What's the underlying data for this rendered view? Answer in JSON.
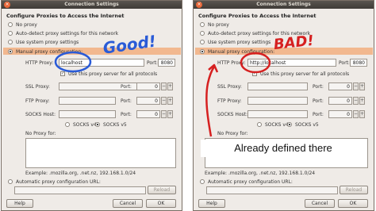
{
  "title": "Connection Settings",
  "heading": "Configure Proxies to Access the Internet",
  "options": {
    "no_proxy": "No proxy",
    "auto_detect": "Auto-detect proxy settings for this network",
    "system": "Use system proxy settings",
    "manual": "Manual proxy configuration:"
  },
  "labels": {
    "http_proxy": "HTTP Proxy:",
    "port": "Port:",
    "use_all": "Use this proxy server for all protocols",
    "ssl": "SSL Proxy:",
    "ftp": "FTP Proxy:",
    "socks": "SOCKS Host:",
    "socks_v4": "SOCKS v4",
    "socks_v5": "SOCKS v5",
    "no_proxy_for": "No Proxy for:",
    "example": "Example: .mozilla.org, .net.nz, 192.168.1.0/24",
    "auto_url": "Automatic proxy configuration URL:"
  },
  "buttons": {
    "reload": "Reload",
    "help": "Help",
    "cancel": "Cancel",
    "ok": "OK"
  },
  "left": {
    "http_value": "localhost",
    "http_port": "8080",
    "port_zero": "0",
    "annotation": "Good!"
  },
  "right": {
    "http_value": "http://localhost",
    "http_port": "8080",
    "port_zero": "0",
    "annotation": "BAD!",
    "callout": "Already defined there"
  },
  "colors": {
    "annotation_blue": "#2a5bd7",
    "annotation_red": "#d62020",
    "selection_orange": "#f2b88f"
  }
}
